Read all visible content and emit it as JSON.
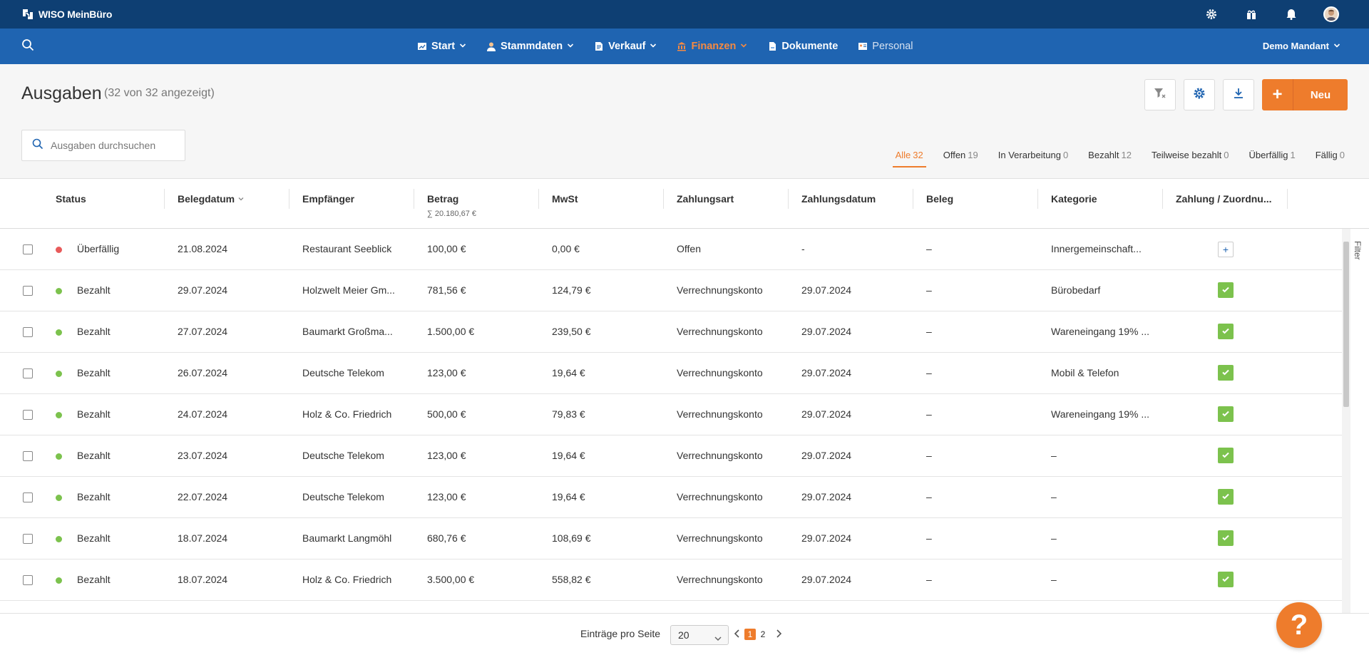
{
  "app": {
    "logo_text": "WISO MeinBüro",
    "mandant": "Demo Mandant"
  },
  "nav": {
    "items": [
      {
        "label": "Start",
        "icon": "chart-icon"
      },
      {
        "label": "Stammdaten",
        "icon": "person-icon"
      },
      {
        "label": "Verkauf",
        "icon": "document-icon"
      },
      {
        "label": "Finanzen",
        "icon": "bank-icon"
      },
      {
        "label": "Dokumente",
        "icon": "files-icon"
      },
      {
        "label": "Personal",
        "icon": "id-card-icon"
      }
    ]
  },
  "header": {
    "title": "Ausgaben",
    "subtitle": "(32 von 32 angezeigt)",
    "new_label": "Neu",
    "new_plus": "+"
  },
  "search": {
    "placeholder": "Ausgaben durchsuchen"
  },
  "filters": [
    {
      "label": "Alle",
      "count": "32"
    },
    {
      "label": "Offen",
      "count": "19"
    },
    {
      "label": "In Verarbeitung",
      "count": "0"
    },
    {
      "label": "Bezahlt",
      "count": "12"
    },
    {
      "label": "Teilweise bezahlt",
      "count": "0"
    },
    {
      "label": "Überfällig",
      "count": "1"
    },
    {
      "label": "Fällig",
      "count": "0"
    }
  ],
  "table": {
    "columns": {
      "status": "Status",
      "belegdatum": "Belegdatum",
      "empfaenger": "Empfänger",
      "betrag": "Betrag",
      "betrag_sum": "∑ 20.180,67 €",
      "mwst": "MwSt",
      "zahlungsart": "Zahlungsart",
      "zahlungsdatum": "Zahlungsdatum",
      "beleg": "Beleg",
      "kategorie": "Kategorie",
      "zahlung": "Zahlung / Zuordnu..."
    },
    "rows": [
      {
        "status": "Überfällig",
        "status_color": "#e85a5a",
        "date": "21.08.2024",
        "recipient": "Restaurant Seeblick",
        "amount": "100,00 €",
        "vat": "0,00 €",
        "method": "Offen",
        "paydate": "-",
        "beleg": "–",
        "category": "Innergemeinschaft...",
        "paid": false
      },
      {
        "status": "Bezahlt",
        "status_color": "#7cc24d",
        "date": "29.07.2024",
        "recipient": "Holzwelt Meier Gm...",
        "amount": "781,56 €",
        "vat": "124,79 €",
        "method": "Verrechnungskonto",
        "paydate": "29.07.2024",
        "beleg": "–",
        "category": "Bürobedarf",
        "paid": true
      },
      {
        "status": "Bezahlt",
        "status_color": "#7cc24d",
        "date": "27.07.2024",
        "recipient": "Baumarkt Großma...",
        "amount": "1.500,00 €",
        "vat": "239,50 €",
        "method": "Verrechnungskonto",
        "paydate": "29.07.2024",
        "beleg": "–",
        "category": "Wareneingang 19% ...",
        "paid": true
      },
      {
        "status": "Bezahlt",
        "status_color": "#7cc24d",
        "date": "26.07.2024",
        "recipient": "Deutsche Telekom",
        "amount": "123,00 €",
        "vat": "19,64 €",
        "method": "Verrechnungskonto",
        "paydate": "29.07.2024",
        "beleg": "–",
        "category": "Mobil & Telefon",
        "paid": true
      },
      {
        "status": "Bezahlt",
        "status_color": "#7cc24d",
        "date": "24.07.2024",
        "recipient": "Holz & Co. Friedrich",
        "amount": "500,00 €",
        "vat": "79,83 €",
        "method": "Verrechnungskonto",
        "paydate": "29.07.2024",
        "beleg": "–",
        "category": "Wareneingang 19% ...",
        "paid": true
      },
      {
        "status": "Bezahlt",
        "status_color": "#7cc24d",
        "date": "23.07.2024",
        "recipient": "Deutsche Telekom",
        "amount": "123,00 €",
        "vat": "19,64 €",
        "method": "Verrechnungskonto",
        "paydate": "29.07.2024",
        "beleg": "–",
        "category": "–",
        "paid": true
      },
      {
        "status": "Bezahlt",
        "status_color": "#7cc24d",
        "date": "22.07.2024",
        "recipient": "Deutsche Telekom",
        "amount": "123,00 €",
        "vat": "19,64 €",
        "method": "Verrechnungskonto",
        "paydate": "29.07.2024",
        "beleg": "–",
        "category": "–",
        "paid": true
      },
      {
        "status": "Bezahlt",
        "status_color": "#7cc24d",
        "date": "18.07.2024",
        "recipient": "Baumarkt Langmöhl",
        "amount": "680,76 €",
        "vat": "108,69 €",
        "method": "Verrechnungskonto",
        "paydate": "29.07.2024",
        "beleg": "–",
        "category": "–",
        "paid": true
      },
      {
        "status": "Bezahlt",
        "status_color": "#7cc24d",
        "date": "18.07.2024",
        "recipient": "Holz & Co. Friedrich",
        "amount": "3.500,00 €",
        "vat": "558,82 €",
        "method": "Verrechnungskonto",
        "paydate": "29.07.2024",
        "beleg": "–",
        "category": "–",
        "paid": true
      }
    ]
  },
  "side_filter_label": "Filter",
  "pager": {
    "label": "Einträge pro Seite",
    "per_page": "20",
    "pages": [
      "1",
      "2"
    ],
    "current": "1"
  },
  "help_label": "?"
}
